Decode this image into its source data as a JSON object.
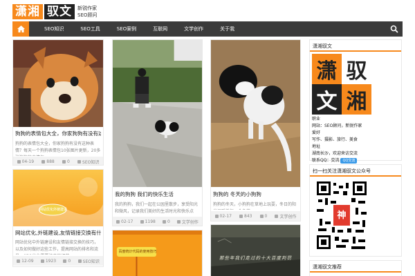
{
  "header": {
    "logo_orange": "潇湘",
    "logo_dark": "驭文",
    "slogan_line1": "新锐作家",
    "slogan_line2": "SEO顾问"
  },
  "nav": {
    "items": [
      "SEO知识",
      "SEO工具",
      "SEO案例",
      "互联网",
      "文学创作",
      "关于我"
    ]
  },
  "cards": [
    {
      "title": "狗狗的表情包大全，你家狗狗有没有这种表情？",
      "excerpt": "狗狗的表情包大全，你家狗狗有没有这种表情？每天一个狗狗表情包10张图片更新，20多张狗狗的表情包。",
      "date": "04-19",
      "views": "888",
      "comments": "0",
      "category": "SEO知识"
    },
    {
      "title": "我的狗狗 我们的快乐生活",
      "excerpt": "我的狗狗，我们一起在公园里散步，享受阳光和微风，记录我们美好的生活时光和快乐点滴。",
      "date": "02-17",
      "views": "1198",
      "comments": "0",
      "category": "文学创作"
    },
    {
      "title": "狗狗的 冬天的小狗狗",
      "excerpt": "狗狗的冬天，小狗狗在草地上玩耍，冬日的阳光温暖着每一个角落。",
      "date": "02-17",
      "views": "843",
      "comments": "0",
      "category": "文学创作"
    },
    {
      "title": "网站优化,外链建设,友情链接交换有什么技巧?怎样做好?",
      "excerpt": "网站优化中外链建设和友情链接交换的技巧，以及如何做好这些工作，提高网站的排名和流量。SEO优化需要注意的细节。",
      "date": "12-09",
      "views": "1923",
      "comments": "0",
      "category": "SEO知识"
    }
  ],
  "banners": {
    "card4_bubble": "网站优化外链建设",
    "card5_bubble": "百度统计代码的使用技巧",
    "card6_text": "那些年我们走过的十大百度判罚"
  },
  "sidebar": {
    "widget1_title": "潇湘驭文",
    "big_logo": [
      "潇",
      "驭",
      "文",
      "湘"
    ],
    "info_lines": [
      "职业",
      "网站：SEO顾问，新锐作家",
      "爱好",
      "写作、摄影、旅行、美食",
      "地址",
      "湖南长沙，欢迎来访交流",
      "联系QQ：交流"
    ],
    "qq_badge": "QQ交流",
    "widget2_title": "扫一扫关注潇湘驭文公众号",
    "qr_badge": "神",
    "widget3_title": "潇湘驭文推荐"
  },
  "colors": {
    "accent": "#f7891c",
    "nav_bg": "#3b3b3b"
  }
}
